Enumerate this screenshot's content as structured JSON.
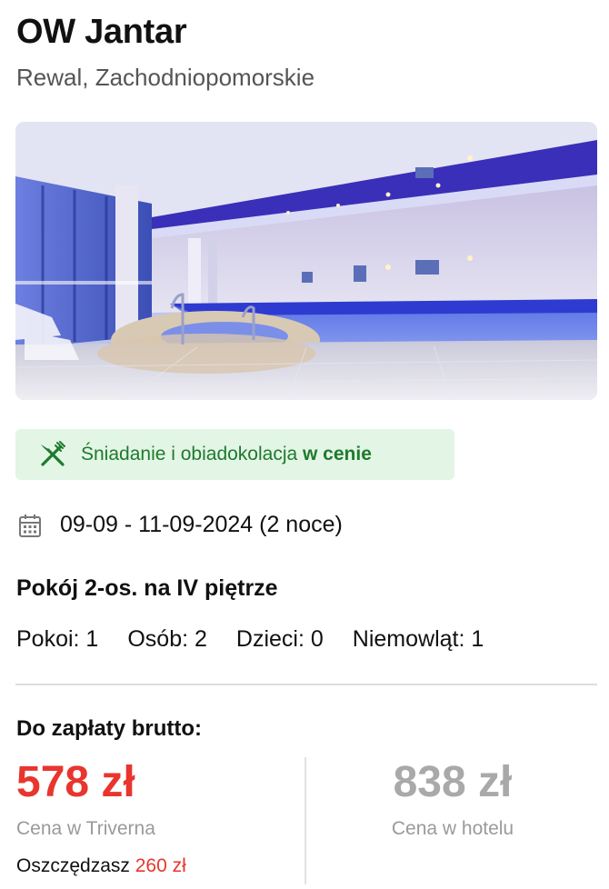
{
  "hotel": {
    "name": "OW Jantar",
    "location": "Rewal, Zachodniopomorskie",
    "photo_icon": "hotel-pool-photo"
  },
  "meal_badge": {
    "icon": "fork-knife-icon",
    "text": "Śniadanie i obiadokolacja ",
    "emphasis": "w cenie",
    "color": "#1e7a2f",
    "background": "#e3f5e4"
  },
  "stay": {
    "icon": "calendar-icon",
    "dates": "09-09 - 11-09-2024 (2 noce)"
  },
  "room": {
    "name": "Pokój 2-os. na IV piętrze"
  },
  "occupancy": {
    "rooms": "Pokoi: 1",
    "adults": "Osób: 2",
    "children": "Dzieci: 0",
    "infants": "Niemowląt: 1"
  },
  "pricing": {
    "label": "Do zapłaty brutto:",
    "main_price": "578 zł",
    "main_caption": "Cena w Triverna",
    "savings_label": "Oszczędzasz ",
    "savings_amount": "260 zł",
    "hotel_price": "838 zł",
    "hotel_caption": "Cena w hotelu",
    "accent_color": "#e8352e"
  }
}
